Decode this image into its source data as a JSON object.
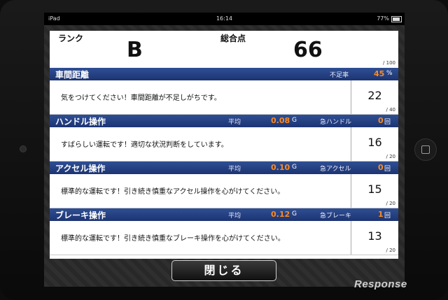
{
  "status": {
    "device": "iPad",
    "time": "16:14",
    "battery": "77%",
    "battery_level": 0.77
  },
  "summary": {
    "rank_label": "ランク",
    "rank_value": "B",
    "total_label": "総合点",
    "total_value": "66",
    "total_max": "/ 100"
  },
  "sections": [
    {
      "title": "車間距離",
      "stat1_label": "不足率",
      "stat1_value": "45",
      "stat1_unit": "%",
      "message": "気をつけてください！車間距離が不足しがちです。",
      "score": "22",
      "max": "/ 40"
    },
    {
      "title": "ハンドル操作",
      "stat1_label": "平均",
      "stat1_value": "0.08",
      "stat1_unit": "G",
      "stat2_label": "急ハンドル",
      "stat2_value": "0",
      "stat2_unit": "回",
      "message": "すばらしい運転です！適切な状況判断をしています。",
      "score": "16",
      "max": "/ 20"
    },
    {
      "title": "アクセル操作",
      "stat1_label": "平均",
      "stat1_value": "0.10",
      "stat1_unit": "G",
      "stat2_label": "急アクセル",
      "stat2_value": "0",
      "stat2_unit": "回",
      "message": "標準的な運転です！引き続き慎重なアクセル操作を心がけてください。",
      "score": "15",
      "max": "/ 20"
    },
    {
      "title": "ブレーキ操作",
      "stat1_label": "平均",
      "stat1_value": "0.12",
      "stat1_unit": "G",
      "stat2_label": "急ブレーキ",
      "stat2_value": "1",
      "stat2_unit": "回",
      "message": "標準的な運転です！引き続き慎重なブレーキ操作を心がけてください。",
      "score": "13",
      "max": "/ 20"
    }
  ],
  "close_button": "閉じる",
  "watermark": "Response",
  "colors": {
    "header_blue": "#1c3472",
    "accent_orange": "#ff8a1e"
  }
}
